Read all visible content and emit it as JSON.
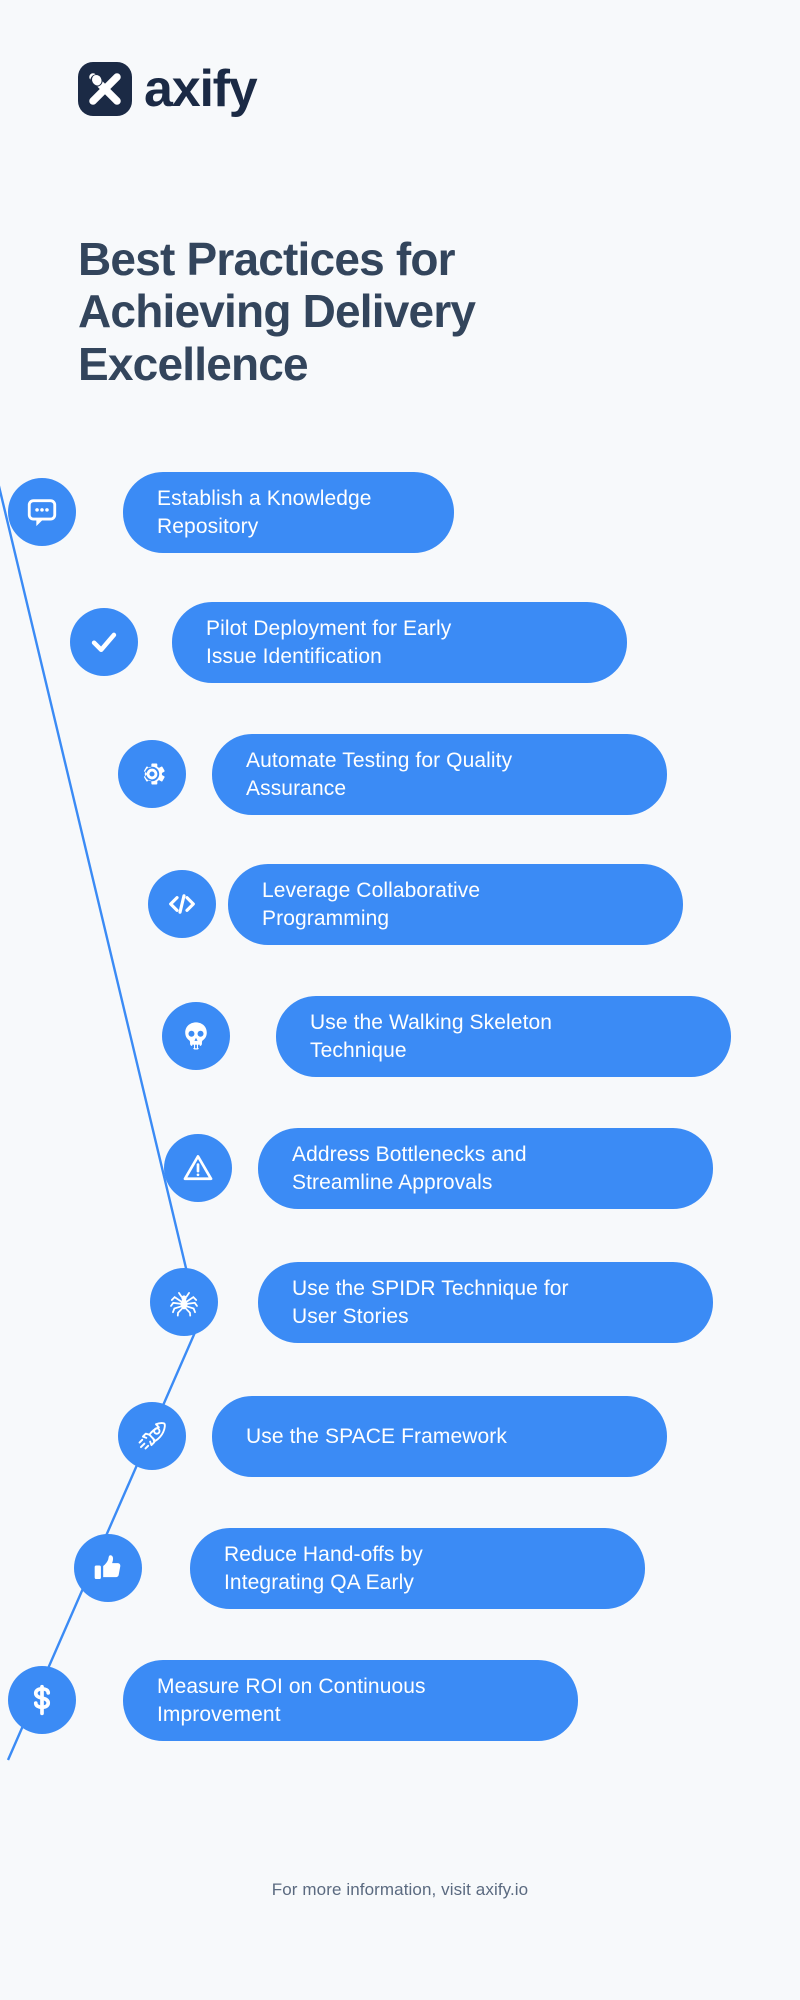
{
  "brand": {
    "logo_icon": "axify-logo-icon",
    "wordmark": "axify",
    "logo_color": "#1b2a45"
  },
  "header": {
    "title": "Best Practices for\nAchieving Delivery\nExcellence",
    "title_color": "#33455c"
  },
  "theme": {
    "background": "#f7f9fb",
    "accent": "#3b8bf5",
    "line": "#3b8bf5",
    "pill_text": "#ffffff",
    "footer_text": "#5b6a80"
  },
  "timeline": {
    "items": [
      {
        "index": 1,
        "icon": "chat-bubble-icon",
        "label": "Establish a Knowledge\nRepository"
      },
      {
        "index": 2,
        "icon": "check-icon",
        "label": "Pilot Deployment for Early\nIssue Identification"
      },
      {
        "index": 3,
        "icon": "gear-icon",
        "label": "Automate Testing for Quality\nAssurance"
      },
      {
        "index": 4,
        "icon": "code-icon",
        "label": "Leverage Collaborative\nProgramming"
      },
      {
        "index": 5,
        "icon": "skull-icon",
        "label": "Use the Walking Skeleton\nTechnique"
      },
      {
        "index": 6,
        "icon": "warning-triangle-icon",
        "label": "Address Bottlenecks and\nStreamline Approvals"
      },
      {
        "index": 7,
        "icon": "spider-icon",
        "label": "Use the SPIDR Technique for\nUser Stories"
      },
      {
        "index": 8,
        "icon": "rocket-icon",
        "label": "Use the SPACE Framework"
      },
      {
        "index": 9,
        "icon": "thumbs-up-icon",
        "label": "Reduce Hand-offs by\nIntegrating QA Early"
      },
      {
        "index": 10,
        "icon": "dollar-icon",
        "label": "Measure ROI on Continuous\nImprovement"
      }
    ]
  },
  "footer": {
    "text": "For more information, visit axify.io"
  }
}
